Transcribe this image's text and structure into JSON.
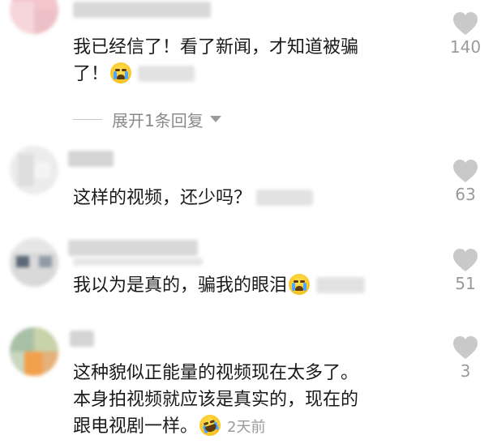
{
  "comments": [
    {
      "text_line1": "我已经信了！看了新闻，才知道被骗",
      "text_line2": "了！",
      "like_count": "140",
      "reply_expander": "展开1条回复"
    },
    {
      "text": "这样的视频，还少吗？",
      "like_count": "63"
    },
    {
      "text": "我以为是真的，骗我的眼泪",
      "like_count": "51"
    },
    {
      "text_line1": "这种貌似正能量的视频现在太多了。",
      "text_line2": "本身拍视频就应该是真实的，现在的",
      "text_line3": "跟电视剧一样。",
      "timestamp": "2天前",
      "like_count": "3"
    }
  ],
  "colors": {
    "text": "#1a1a1a",
    "meta": "#9a9a9a",
    "heart": "#c9c9c9"
  },
  "icons": [
    "heart-icon",
    "chevron-down-icon",
    "crying-emoji",
    "laughing-crying-emoji"
  ]
}
